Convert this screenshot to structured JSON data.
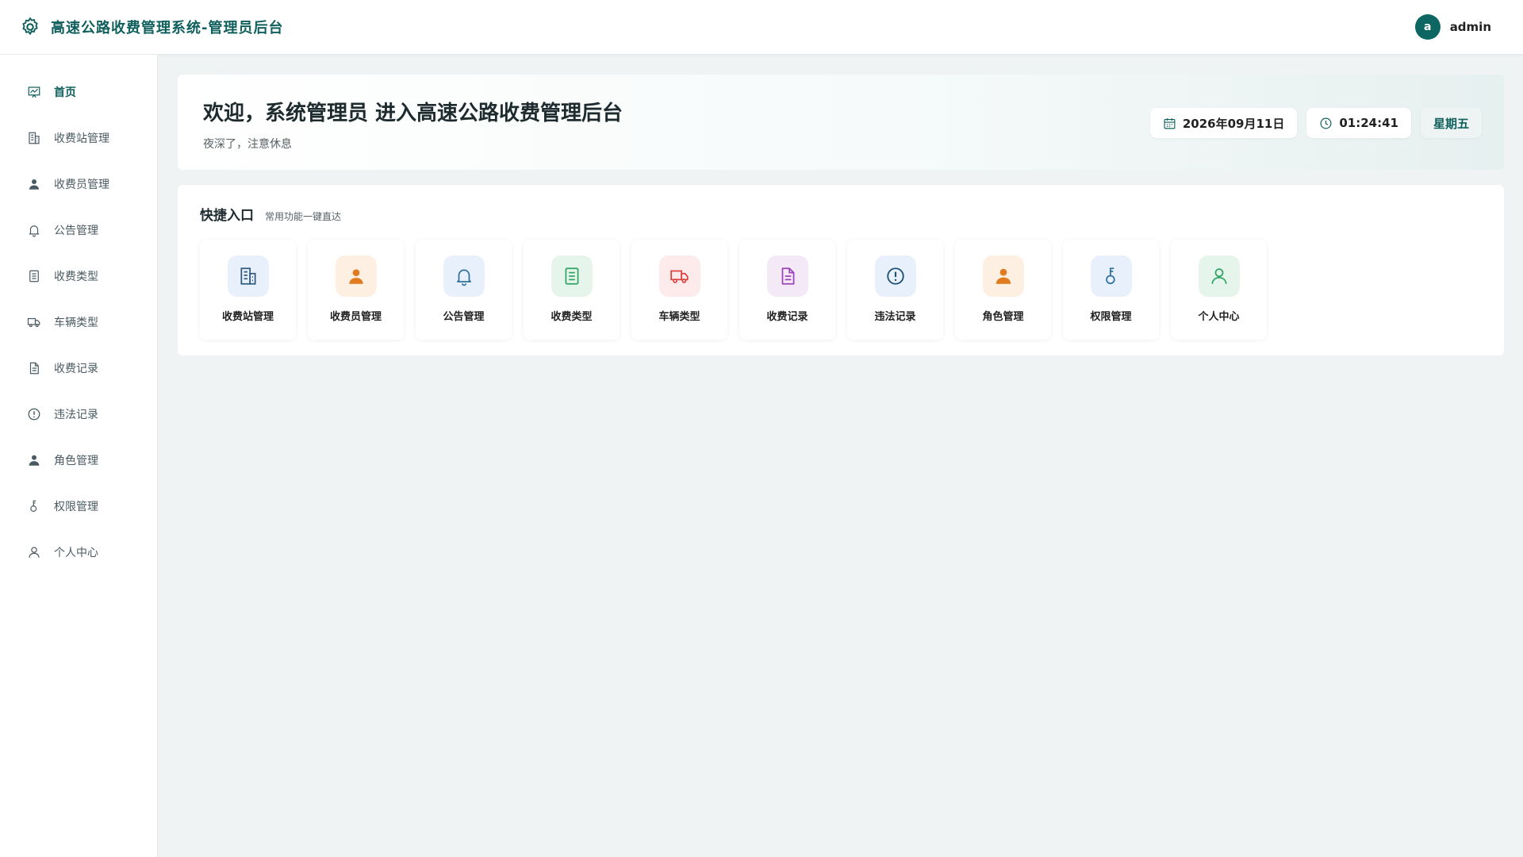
{
  "header": {
    "title": "高速公路收费管理系统-管理员后台",
    "logo_icon": "gear-icon",
    "user": {
      "avatar_letter": "a",
      "name": "admin"
    }
  },
  "sidebar": {
    "items": [
      {
        "label": "首页",
        "icon": "home-chart-icon",
        "active": true
      },
      {
        "label": "收费站管理",
        "icon": "building-icon"
      },
      {
        "label": "收费员管理",
        "icon": "user-icon"
      },
      {
        "label": "公告管理",
        "icon": "bell-icon"
      },
      {
        "label": "收费类型",
        "icon": "list-doc-icon"
      },
      {
        "label": "车辆类型",
        "icon": "truck-icon"
      },
      {
        "label": "收费记录",
        "icon": "document-icon"
      },
      {
        "label": "违法记录",
        "icon": "warning-circle-icon"
      },
      {
        "label": "角色管理",
        "icon": "user-role-icon"
      },
      {
        "label": "权限管理",
        "icon": "key-icon"
      },
      {
        "label": "个人中心",
        "icon": "person-outline-icon"
      }
    ]
  },
  "welcome": {
    "title": "欢迎，系统管理员 进入高速公路收费管理后台",
    "subtitle": "夜深了，注意休息",
    "date": "2026年09月11日",
    "time": "01:24:41",
    "weekday": "星期五"
  },
  "quick": {
    "title": "快捷入口",
    "subtitle": "常用功能一键直达",
    "tiles": [
      {
        "label": "收费站管理",
        "icon": "building-icon",
        "bg": "#e8f1fb",
        "fg": "#2f5a7d"
      },
      {
        "label": "收费员管理",
        "icon": "user-icon",
        "bg": "#fdf0e2",
        "fg": "#e07b1f"
      },
      {
        "label": "公告管理",
        "icon": "bell-icon",
        "bg": "#e8f1fb",
        "fg": "#2f6f9e"
      },
      {
        "label": "收费类型",
        "icon": "list-doc-icon",
        "bg": "#e6f5ec",
        "fg": "#2fa564"
      },
      {
        "label": "车辆类型",
        "icon": "truck-icon",
        "bg": "#fdeaea",
        "fg": "#d9423f"
      },
      {
        "label": "收费记录",
        "icon": "document-icon",
        "bg": "#f4eaf7",
        "fg": "#9b43b8"
      },
      {
        "label": "违法记录",
        "icon": "warning-circle-icon",
        "bg": "#e8f1fb",
        "fg": "#1f4f73"
      },
      {
        "label": "角色管理",
        "icon": "user-role-icon",
        "bg": "#fdf0e2",
        "fg": "#e07b1f"
      },
      {
        "label": "权限管理",
        "icon": "key-icon",
        "bg": "#e8f1fb",
        "fg": "#2f6f9e"
      },
      {
        "label": "个人中心",
        "icon": "person-outline-icon",
        "bg": "#e6f5ec",
        "fg": "#2fa564"
      }
    ]
  },
  "colors": {
    "brand": "#0f5f5c",
    "page_bg": "#eff3f3",
    "sidebar_text": "#4a5a62"
  }
}
